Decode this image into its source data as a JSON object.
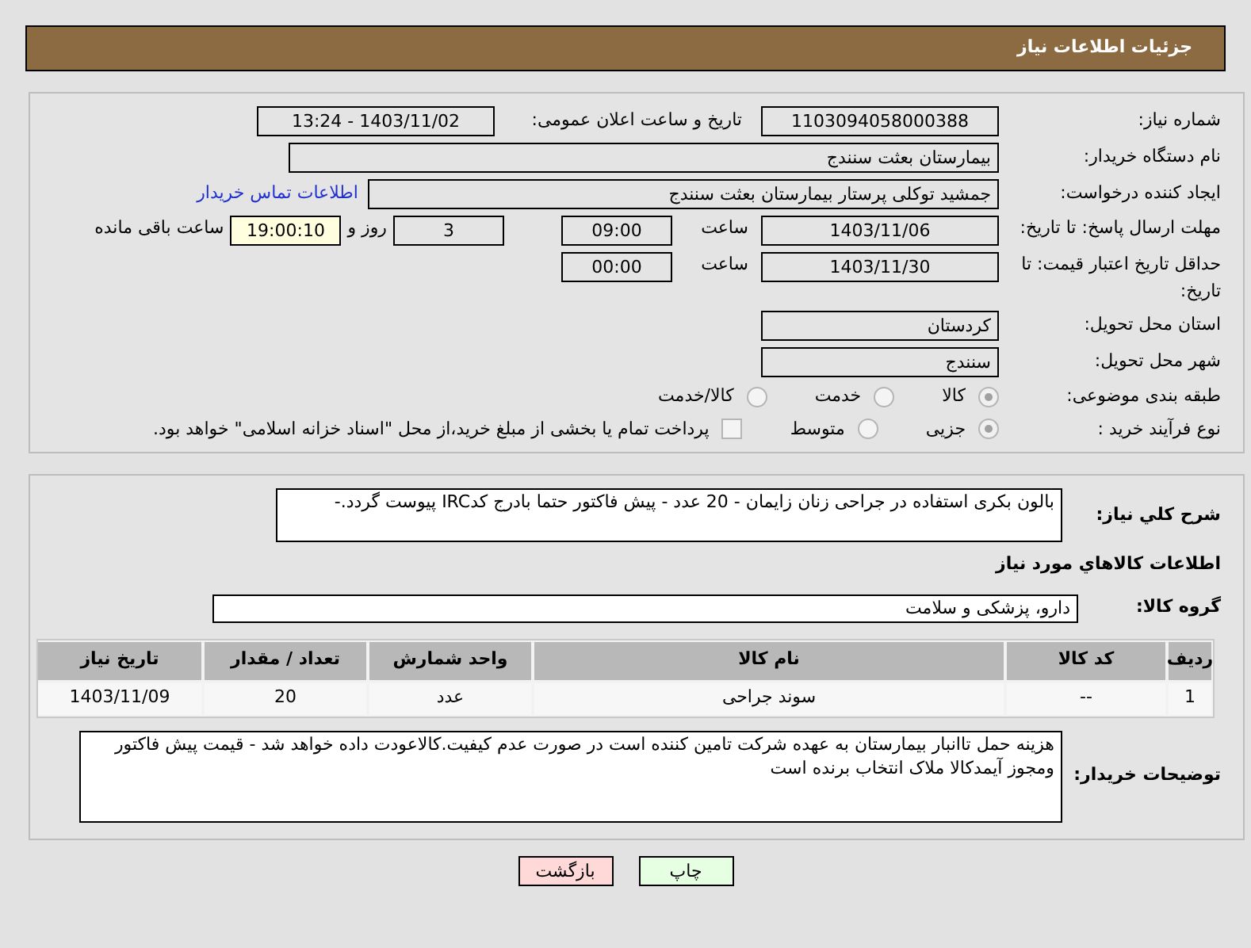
{
  "header": {
    "title": "جزئیات اطلاعات نیاز"
  },
  "details": {
    "need_number": {
      "label": "شماره نیاز:",
      "value": "1103094058000388"
    },
    "announce": {
      "label": "تاریخ و ساعت اعلان عمومی:",
      "value": "1403/11/02 - 13:24"
    },
    "buyer_org": {
      "label": "نام دستگاه خریدار:",
      "value": "بیمارستان بعثت سنندج"
    },
    "requester": {
      "label": "ایجاد کننده درخواست:",
      "value": "جمشید  توکلی پرستار بیمارستان بعثت سنندج",
      "link": "اطلاعات تماس خریدار"
    },
    "deadline": {
      "label": "مهلت ارسال پاسخ: تا تاریخ:",
      "date": "1403/11/06",
      "time_label": "ساعت",
      "time": "09:00",
      "days": "3",
      "days_label": "روز و",
      "remaining": "19:00:10",
      "remaining_label": "ساعت باقی مانده"
    },
    "validity": {
      "label": "حداقل تاریخ اعتبار قیمت: تا تاریخ:",
      "date": "1403/11/30",
      "time_label": "ساعت",
      "time": "00:00"
    },
    "province": {
      "label": "استان محل تحویل:",
      "value": "کردستان"
    },
    "city": {
      "label": "شهر محل تحویل:",
      "value": "سنندج"
    },
    "category": {
      "label": "طبقه بندی موضوعی:",
      "options": [
        {
          "label": "کالا",
          "selected": true
        },
        {
          "label": "خدمت",
          "selected": false
        },
        {
          "label": "کالا/خدمت",
          "selected": false
        }
      ]
    },
    "process": {
      "label": "نوع فرآیند خرید :",
      "options": [
        {
          "label": "جزیی",
          "selected": true
        },
        {
          "label": "متوسط",
          "selected": false
        }
      ],
      "payment": {
        "label": "پرداخت تمام یا بخشی از مبلغ خرید،از محل \"اسناد خزانه اسلامی\" خواهد بود.",
        "checked": false
      }
    }
  },
  "needs": {
    "description": {
      "label": "شرح کلي نياز:",
      "value": "بالون بکری استفاده در جراحی زنان زایمان - 20 عدد - پیش فاکتور حتما بادرج کدIRC پیوست گردد.-"
    },
    "goods_heading": "اطلاعات کالاهاي مورد نياز",
    "group": {
      "label": "گروه کالا:",
      "value": "دارو، پزشکی و سلامت"
    },
    "table": {
      "columns": [
        "ردیف",
        "کد کالا",
        "نام کالا",
        "واحد شمارش",
        "تعداد / مقدار",
        "تاریخ نیاز"
      ],
      "rows": [
        [
          "1",
          "--",
          "سوند جراحی",
          "عدد",
          "20",
          "1403/11/09"
        ]
      ]
    },
    "notes": {
      "label": "توضیحات خریدار:",
      "value": "هزینه حمل تاانبار بیمارستان به عهده شرکت تامین کننده است در صورت عدم کیفیت.کالاعودت داده خواهد شد - قیمت پیش فاکتور ومجوز آیمدکالا ملاک انتخاب برنده است"
    }
  },
  "buttons": [
    {
      "label": "چاپ",
      "kind": "print"
    },
    {
      "label": "بازگشت",
      "kind": "back"
    }
  ]
}
